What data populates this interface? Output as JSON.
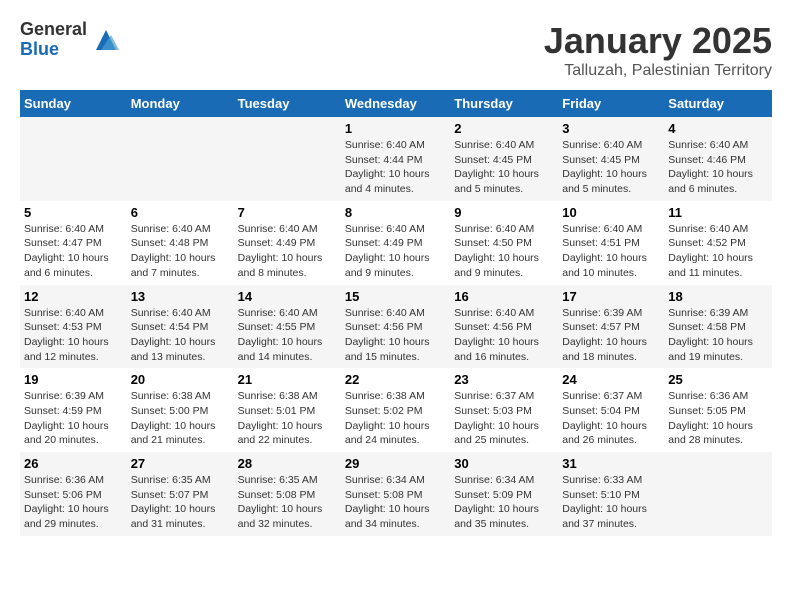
{
  "header": {
    "logo_general": "General",
    "logo_blue": "Blue",
    "title": "January 2025",
    "subtitle": "Talluzah, Palestinian Territory"
  },
  "weekdays": [
    "Sunday",
    "Monday",
    "Tuesday",
    "Wednesday",
    "Thursday",
    "Friday",
    "Saturday"
  ],
  "weeks": [
    [
      {
        "day": "",
        "info": ""
      },
      {
        "day": "",
        "info": ""
      },
      {
        "day": "",
        "info": ""
      },
      {
        "day": "1",
        "info": "Sunrise: 6:40 AM\nSunset: 4:44 PM\nDaylight: 10 hours\nand 4 minutes."
      },
      {
        "day": "2",
        "info": "Sunrise: 6:40 AM\nSunset: 4:45 PM\nDaylight: 10 hours\nand 5 minutes."
      },
      {
        "day": "3",
        "info": "Sunrise: 6:40 AM\nSunset: 4:45 PM\nDaylight: 10 hours\nand 5 minutes."
      },
      {
        "day": "4",
        "info": "Sunrise: 6:40 AM\nSunset: 4:46 PM\nDaylight: 10 hours\nand 6 minutes."
      }
    ],
    [
      {
        "day": "5",
        "info": "Sunrise: 6:40 AM\nSunset: 4:47 PM\nDaylight: 10 hours\nand 6 minutes."
      },
      {
        "day": "6",
        "info": "Sunrise: 6:40 AM\nSunset: 4:48 PM\nDaylight: 10 hours\nand 7 minutes."
      },
      {
        "day": "7",
        "info": "Sunrise: 6:40 AM\nSunset: 4:49 PM\nDaylight: 10 hours\nand 8 minutes."
      },
      {
        "day": "8",
        "info": "Sunrise: 6:40 AM\nSunset: 4:49 PM\nDaylight: 10 hours\nand 9 minutes."
      },
      {
        "day": "9",
        "info": "Sunrise: 6:40 AM\nSunset: 4:50 PM\nDaylight: 10 hours\nand 9 minutes."
      },
      {
        "day": "10",
        "info": "Sunrise: 6:40 AM\nSunset: 4:51 PM\nDaylight: 10 hours\nand 10 minutes."
      },
      {
        "day": "11",
        "info": "Sunrise: 6:40 AM\nSunset: 4:52 PM\nDaylight: 10 hours\nand 11 minutes."
      }
    ],
    [
      {
        "day": "12",
        "info": "Sunrise: 6:40 AM\nSunset: 4:53 PM\nDaylight: 10 hours\nand 12 minutes."
      },
      {
        "day": "13",
        "info": "Sunrise: 6:40 AM\nSunset: 4:54 PM\nDaylight: 10 hours\nand 13 minutes."
      },
      {
        "day": "14",
        "info": "Sunrise: 6:40 AM\nSunset: 4:55 PM\nDaylight: 10 hours\nand 14 minutes."
      },
      {
        "day": "15",
        "info": "Sunrise: 6:40 AM\nSunset: 4:56 PM\nDaylight: 10 hours\nand 15 minutes."
      },
      {
        "day": "16",
        "info": "Sunrise: 6:40 AM\nSunset: 4:56 PM\nDaylight: 10 hours\nand 16 minutes."
      },
      {
        "day": "17",
        "info": "Sunrise: 6:39 AM\nSunset: 4:57 PM\nDaylight: 10 hours\nand 18 minutes."
      },
      {
        "day": "18",
        "info": "Sunrise: 6:39 AM\nSunset: 4:58 PM\nDaylight: 10 hours\nand 19 minutes."
      }
    ],
    [
      {
        "day": "19",
        "info": "Sunrise: 6:39 AM\nSunset: 4:59 PM\nDaylight: 10 hours\nand 20 minutes."
      },
      {
        "day": "20",
        "info": "Sunrise: 6:38 AM\nSunset: 5:00 PM\nDaylight: 10 hours\nand 21 minutes."
      },
      {
        "day": "21",
        "info": "Sunrise: 6:38 AM\nSunset: 5:01 PM\nDaylight: 10 hours\nand 22 minutes."
      },
      {
        "day": "22",
        "info": "Sunrise: 6:38 AM\nSunset: 5:02 PM\nDaylight: 10 hours\nand 24 minutes."
      },
      {
        "day": "23",
        "info": "Sunrise: 6:37 AM\nSunset: 5:03 PM\nDaylight: 10 hours\nand 25 minutes."
      },
      {
        "day": "24",
        "info": "Sunrise: 6:37 AM\nSunset: 5:04 PM\nDaylight: 10 hours\nand 26 minutes."
      },
      {
        "day": "25",
        "info": "Sunrise: 6:36 AM\nSunset: 5:05 PM\nDaylight: 10 hours\nand 28 minutes."
      }
    ],
    [
      {
        "day": "26",
        "info": "Sunrise: 6:36 AM\nSunset: 5:06 PM\nDaylight: 10 hours\nand 29 minutes."
      },
      {
        "day": "27",
        "info": "Sunrise: 6:35 AM\nSunset: 5:07 PM\nDaylight: 10 hours\nand 31 minutes."
      },
      {
        "day": "28",
        "info": "Sunrise: 6:35 AM\nSunset: 5:08 PM\nDaylight: 10 hours\nand 32 minutes."
      },
      {
        "day": "29",
        "info": "Sunrise: 6:34 AM\nSunset: 5:08 PM\nDaylight: 10 hours\nand 34 minutes."
      },
      {
        "day": "30",
        "info": "Sunrise: 6:34 AM\nSunset: 5:09 PM\nDaylight: 10 hours\nand 35 minutes."
      },
      {
        "day": "31",
        "info": "Sunrise: 6:33 AM\nSunset: 5:10 PM\nDaylight: 10 hours\nand 37 minutes."
      },
      {
        "day": "",
        "info": ""
      }
    ]
  ]
}
